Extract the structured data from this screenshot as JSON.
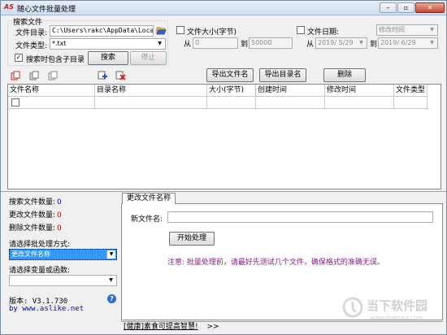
{
  "titlebar": {
    "logo": "AS",
    "title": "随心文件批量处理",
    "min_glyph": "–",
    "max_glyph": "▫",
    "close_glyph": "✕"
  },
  "search": {
    "group_title": "搜索文件",
    "dir_label": "文件目录:",
    "dir_value": "C:\\Users\\rakc\\AppData\\Local\\Te",
    "type_label": "文件类型:",
    "type_value": "*.txt",
    "include_sub_label": "搜索时包含子目录",
    "include_sub_checked": true,
    "search_btn": "搜索",
    "stop_btn": "停止",
    "size_label": "文件大小(字节)",
    "size_from_label": "从",
    "size_from": "0",
    "size_to_label": "到",
    "size_to": "50000",
    "date_label": "文件日期:",
    "date_type": "修改时间",
    "date_from_label": "从",
    "date_from": "2019/ 5/29",
    "date_to_label": "到",
    "date_to": "2019/ 6/29"
  },
  "toolbar": {
    "export_files_btn": "导出文件名",
    "export_dirs_btn": "导出目录名",
    "delete_btn": "删除"
  },
  "table": {
    "columns": [
      "文件名称",
      "目录名称",
      "大小(字节)",
      "创建时间",
      "修改时间",
      "文件类型"
    ]
  },
  "stats": {
    "searched_label": "搜索文件数量:",
    "searched": "0",
    "changed_label": "更改文件数量:",
    "changed": "0",
    "deleted_label": "删除文件数量:",
    "deleted": "0",
    "mode_label": "请选择批处理方式:",
    "mode_value": "更改文件名称",
    "var_label": "请选择变量或函数:",
    "var_value": "",
    "version": "版本: V3.1.730",
    "website": "by www.aslike.net",
    "help_glyph": "?"
  },
  "rename_tab": {
    "tab_label": "更改文件名称",
    "new_name_label": "新文件名:",
    "new_name_value": "",
    "start_btn": "开始处理",
    "notice": "注意: 批量处理前，请最好先测试几个文件，确保格式的准确无误。"
  },
  "statusbar": {
    "text": "[健康]素食可提高智慧!",
    "more": ">>"
  },
  "watermark": {
    "text": "当下软件园",
    "url": "www.downxia.com"
  },
  "colors": {
    "accent_blue": "#0000cc",
    "count_red": "#cc0000",
    "notice_purple": "#8b1a89",
    "selected_bg": "#3399ff"
  }
}
